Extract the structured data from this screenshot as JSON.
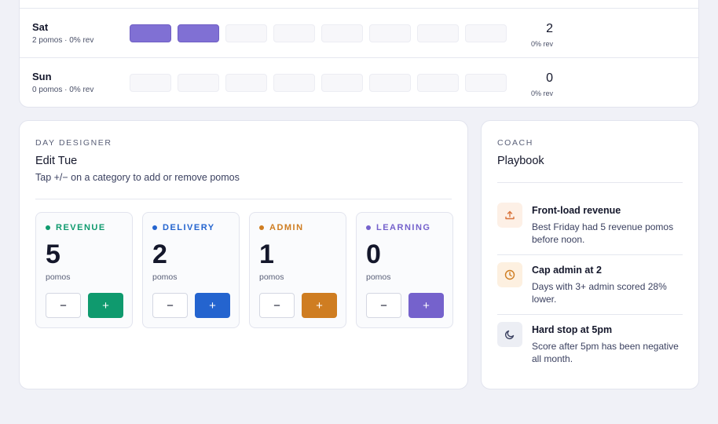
{
  "week": {
    "rows": [
      {
        "day": "Sat",
        "sub": "2 pomos · 0% rev",
        "count": "2",
        "rev": "0% rev",
        "filled": 2
      },
      {
        "day": "Sun",
        "sub": "0 pomos · 0% rev",
        "count": "0",
        "rev": "0% rev",
        "filled": 0
      }
    ],
    "slot_color": "#8070d4"
  },
  "designer": {
    "eyebrow": "DAY DESIGNER",
    "title": "Edit Tue",
    "subtitle": "Tap +/− on a category to add or remove pomos",
    "categories": [
      {
        "label": "REVENUE",
        "count": "5",
        "unit": "pomos",
        "color": "#0f9a6e",
        "minus": "−",
        "plus": "+"
      },
      {
        "label": "DELIVERY",
        "count": "2",
        "unit": "pomos",
        "color": "#2464cf",
        "minus": "−",
        "plus": "+"
      },
      {
        "label": "ADMIN",
        "count": "1",
        "unit": "pomos",
        "color": "#cf7d21",
        "minus": "−",
        "plus": "+"
      },
      {
        "label": "LEARNING",
        "count": "0",
        "unit": "pomos",
        "color": "#7562cc",
        "minus": "−",
        "plus": "+"
      }
    ]
  },
  "coach": {
    "eyebrow": "COACH",
    "title": "Playbook",
    "tips": [
      {
        "icon": "upload-icon",
        "title": "Front-load revenue",
        "body": "Best Friday had 5 revenue pomos before noon.",
        "icon_bg": "#fdf0e6",
        "icon_color": "#d9733a"
      },
      {
        "icon": "clock-icon",
        "title": "Cap admin at 2",
        "body": "Days with 3+ admin scored 28% lower.",
        "icon_bg": "#fdf0e0",
        "icon_color": "#cf7d21"
      },
      {
        "icon": "moon-icon",
        "title": "Hard stop at 5pm",
        "body": "Score after 5pm has been negative all month.",
        "icon_bg": "#eceef4",
        "icon_color": "#3b4160"
      }
    ]
  }
}
